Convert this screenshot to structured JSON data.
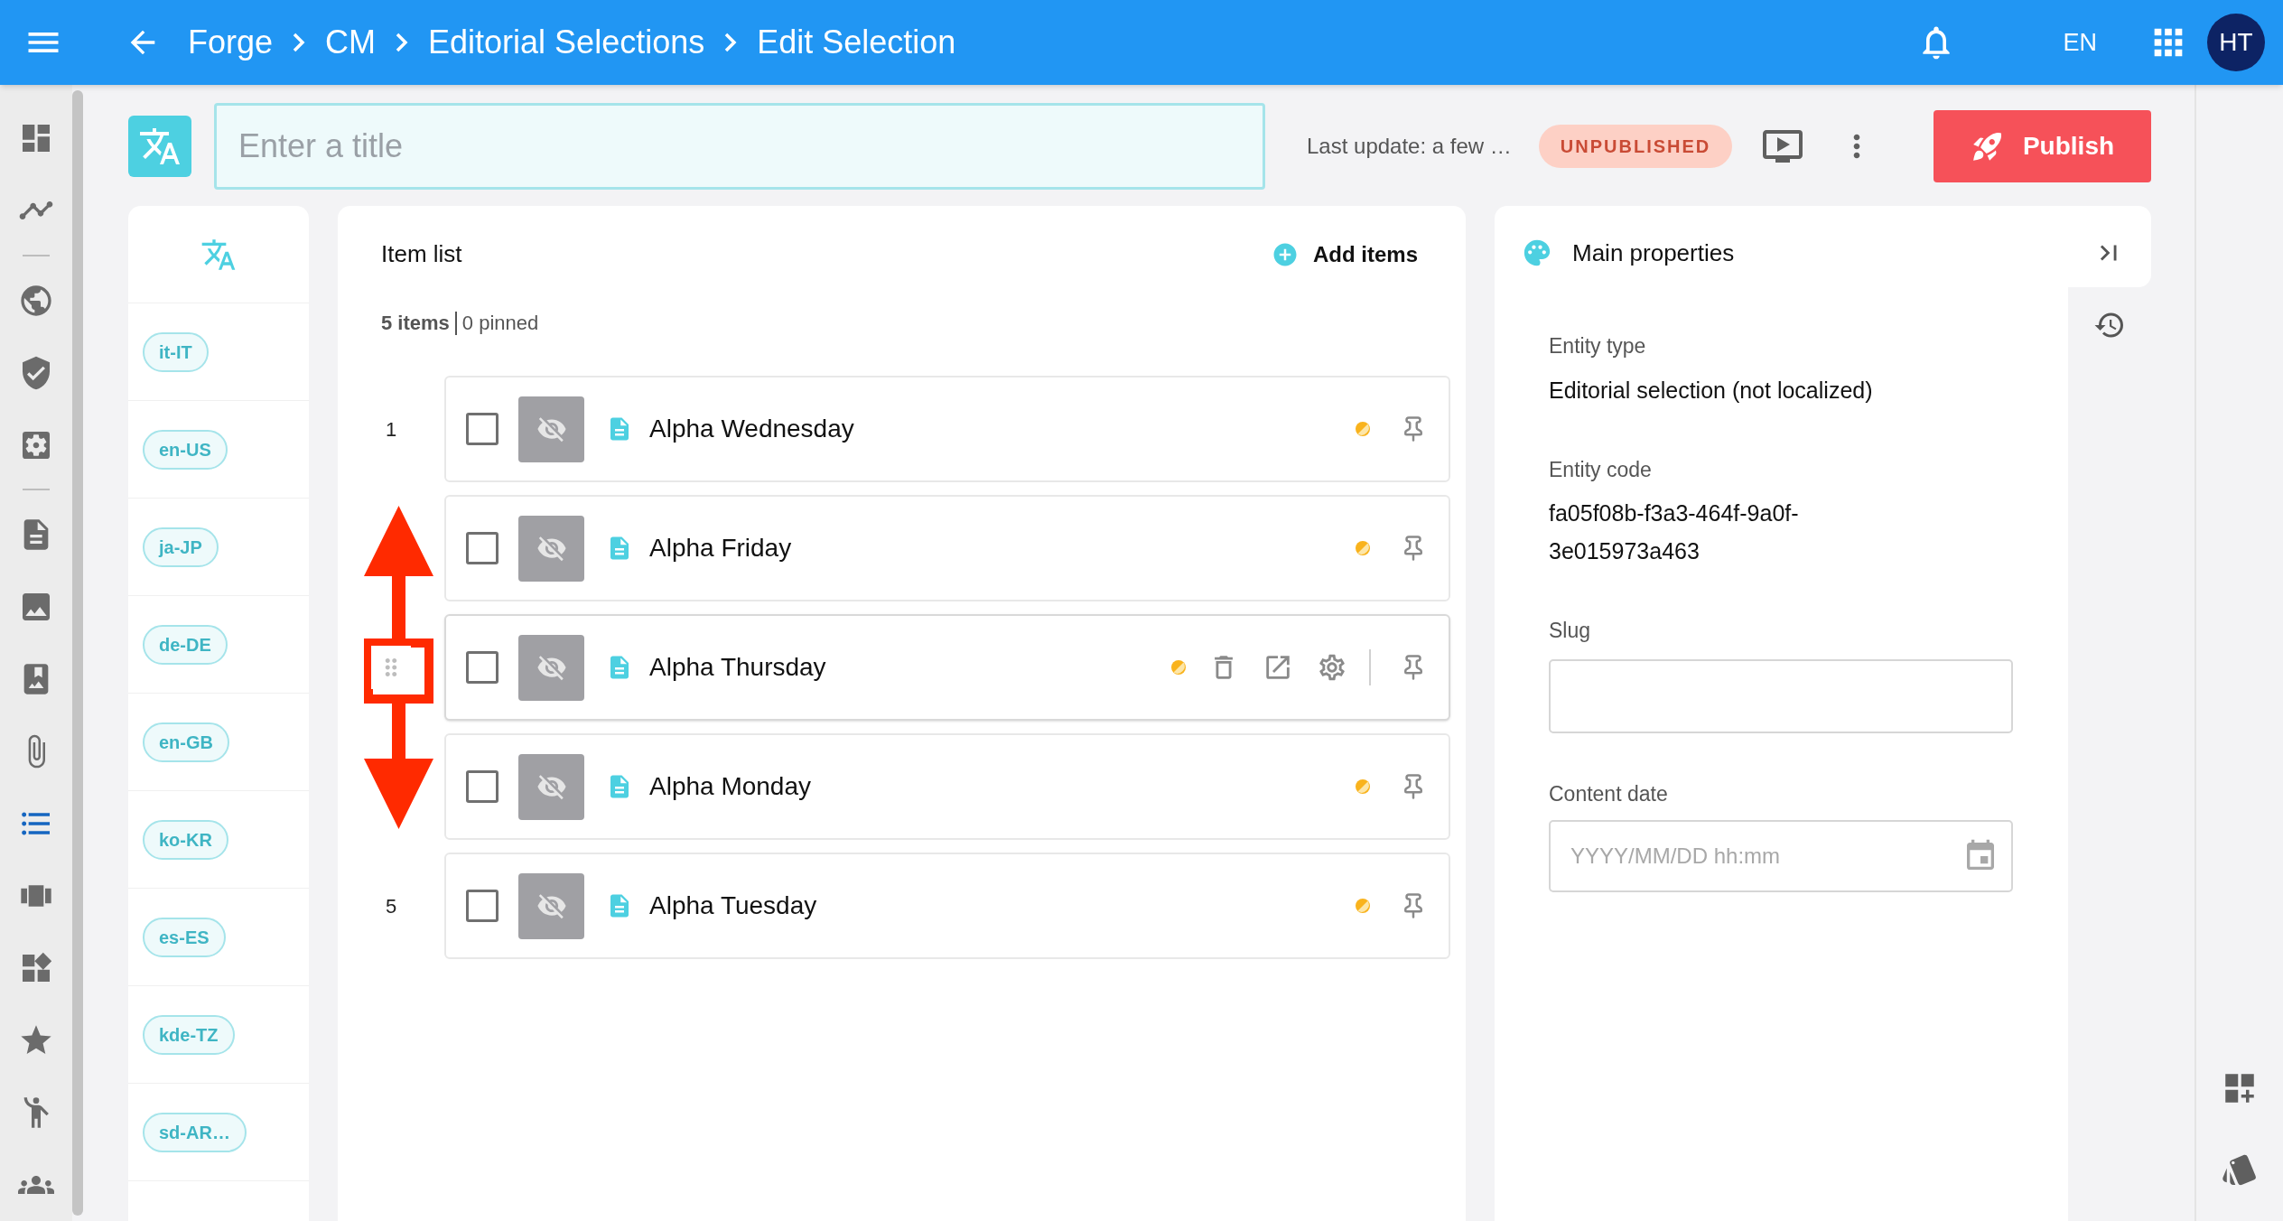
{
  "top_bar": {
    "breadcrumb": [
      "Forge",
      "CM",
      "Editorial Selections",
      "Edit Selection"
    ],
    "language": "EN",
    "avatar": "HT"
  },
  "nav_items": [
    {
      "kind": "icon",
      "selected": false
    },
    {
      "kind": "icon",
      "selected": false
    },
    {
      "kind": "divider"
    },
    {
      "kind": "icon",
      "selected": false
    },
    {
      "kind": "icon",
      "selected": false
    },
    {
      "kind": "icon",
      "selected": false
    },
    {
      "kind": "divider"
    },
    {
      "kind": "icon",
      "selected": false
    },
    {
      "kind": "icon",
      "selected": false
    },
    {
      "kind": "icon",
      "selected": false
    },
    {
      "kind": "icon",
      "selected": false
    },
    {
      "kind": "icon",
      "selected": true
    },
    {
      "kind": "icon",
      "selected": false
    },
    {
      "kind": "icon",
      "selected": false
    },
    {
      "kind": "icon",
      "selected": false
    },
    {
      "kind": "icon",
      "selected": false
    },
    {
      "kind": "icon",
      "selected": false
    }
  ],
  "title_bar": {
    "placeholder": "Enter a title",
    "last_update": "Last update: a few …",
    "status": "UNPUBLISHED",
    "publish": "Publish"
  },
  "languages": [
    "it-IT",
    "en-US",
    "ja-JP",
    "de-DE",
    "en-GB",
    "ko-KR",
    "es-ES",
    "kde-TZ",
    "sd-AR…"
  ],
  "item_list": {
    "title": "Item list",
    "add": "Add items",
    "count": "5 items",
    "pinned": "0 pinned",
    "items": [
      {
        "number": "1",
        "name": "Alpha Wednesday",
        "checked": false,
        "hovered": false
      },
      {
        "name": "Alpha Friday",
        "checked": false,
        "hovered": false
      },
      {
        "name": "Alpha Thursday",
        "checked": false,
        "hovered": true
      },
      {
        "name": "Alpha Monday",
        "checked": false,
        "hovered": false
      },
      {
        "number": "5",
        "name": "Alpha Tuesday",
        "checked": false,
        "hovered": false
      }
    ]
  },
  "properties": {
    "title": "Main properties",
    "fields": [
      {
        "kind": "text",
        "label": "Entity type",
        "value": "Editorial selection (not localized)"
      },
      {
        "kind": "text",
        "label": "Entity code",
        "value": "fa05f08b-f3a3-464f-9a0f-3e015973a463"
      },
      {
        "kind": "input",
        "label": "Slug"
      },
      {
        "kind": "date",
        "label": "Content date",
        "placeholder": "YYYY/MM/DD hh:mm"
      }
    ]
  }
}
